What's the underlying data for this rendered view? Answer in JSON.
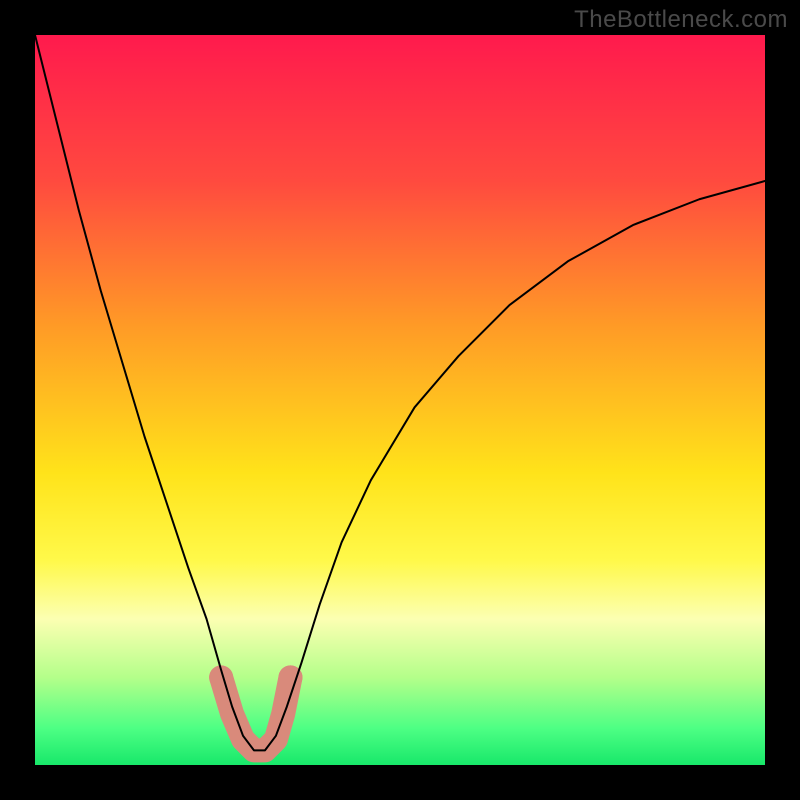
{
  "watermark": "TheBottleneck.com",
  "chart_data": {
    "type": "line",
    "title": "",
    "xlabel": "",
    "ylabel": "",
    "xlim": [
      0,
      100
    ],
    "ylim": [
      0,
      100
    ],
    "background_gradient": {
      "stops": [
        {
          "offset": 0.0,
          "color": "#ff1a4d"
        },
        {
          "offset": 0.2,
          "color": "#ff4a3f"
        },
        {
          "offset": 0.4,
          "color": "#ff9b26"
        },
        {
          "offset": 0.6,
          "color": "#ffe31a"
        },
        {
          "offset": 0.72,
          "color": "#fff94a"
        },
        {
          "offset": 0.8,
          "color": "#fcffb2"
        },
        {
          "offset": 0.88,
          "color": "#b4ff8a"
        },
        {
          "offset": 0.95,
          "color": "#4dff84"
        },
        {
          "offset": 1.0,
          "color": "#18e86a"
        }
      ]
    },
    "series": [
      {
        "name": "bottleneck-curve",
        "color": "#000000",
        "width": 2,
        "x": [
          0.0,
          3.0,
          6.0,
          9.0,
          12.0,
          15.0,
          18.0,
          21.0,
          23.5,
          25.5,
          27.0,
          28.5,
          30.0,
          31.5,
          33.0,
          34.5,
          36.5,
          39.0,
          42.0,
          46.0,
          52.0,
          58.0,
          65.0,
          73.0,
          82.0,
          91.0,
          100.0
        ],
        "y": [
          100.0,
          88.0,
          76.0,
          65.0,
          55.0,
          45.0,
          36.0,
          27.0,
          20.0,
          13.0,
          8.0,
          4.0,
          2.0,
          2.0,
          4.0,
          8.0,
          14.0,
          22.0,
          30.5,
          39.0,
          49.0,
          56.0,
          63.0,
          69.0,
          74.0,
          77.5,
          80.0
        ]
      }
    ],
    "highlight_band": {
      "name": "optimal-zone",
      "color": "#d98a7b",
      "points": [
        {
          "x": 25.5,
          "y": 12.0
        },
        {
          "x": 27.0,
          "y": 7.0
        },
        {
          "x": 28.5,
          "y": 3.5
        },
        {
          "x": 30.0,
          "y": 2.0
        },
        {
          "x": 31.5,
          "y": 2.0
        },
        {
          "x": 33.0,
          "y": 3.5
        },
        {
          "x": 34.0,
          "y": 7.0
        },
        {
          "x": 35.0,
          "y": 12.0
        }
      ],
      "width": 24,
      "end_radius": 12
    }
  }
}
